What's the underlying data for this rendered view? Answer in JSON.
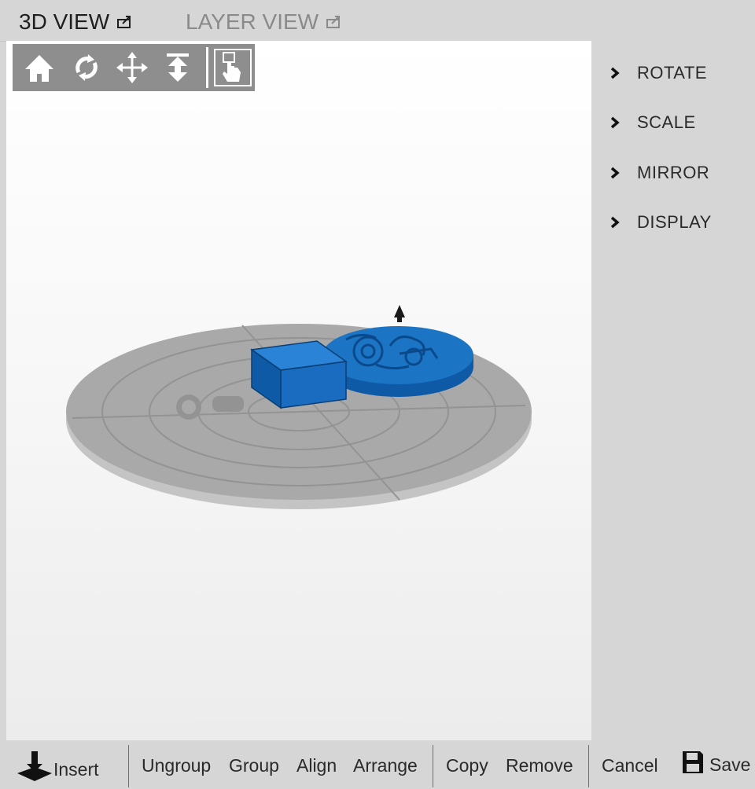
{
  "tabs": {
    "view3d": "3D VIEW",
    "layer_view": "LAYER VIEW"
  },
  "toolbar": {
    "tools": [
      "home-icon",
      "rotate-view-icon",
      "pan-icon",
      "lift-icon",
      "select-icon"
    ]
  },
  "side_panel": {
    "items": [
      "ROTATE",
      "SCALE",
      "MIRROR",
      "DISPLAY"
    ]
  },
  "bottom_bar": {
    "insert": "Insert",
    "ungroup": "Ungroup",
    "group": "Group",
    "align": "Align",
    "arrange": "Arrange",
    "copy": "Copy",
    "remove": "Remove",
    "cancel": "Cancel",
    "save": "Save"
  },
  "colors": {
    "model_blue": "#1c74c4",
    "platform_gray": "#a9a9a9",
    "toolbar_bg": "#8e8e8e"
  }
}
